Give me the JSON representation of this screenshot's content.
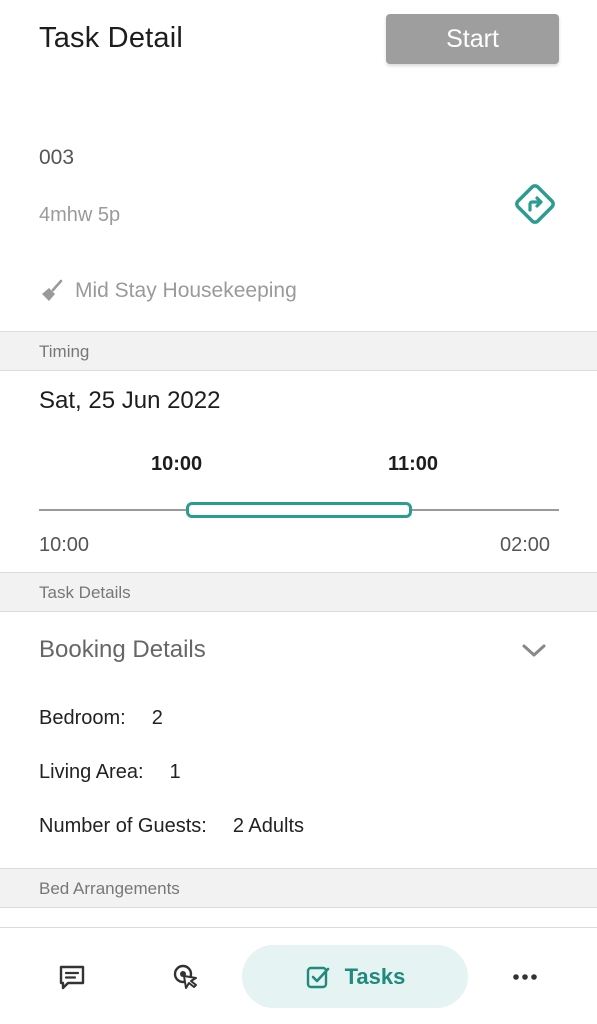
{
  "header": {
    "title": "Task Detail",
    "start_label": "Start"
  },
  "task": {
    "id": "003",
    "subtitle": "4mhw 5p",
    "type": "Mid Stay Housekeeping"
  },
  "sections": {
    "timing": "Timing",
    "task_details": "Task Details",
    "bed_arrangements": "Bed Arrangements"
  },
  "timing": {
    "date": "Sat, 25 Jun 2022",
    "window_start": "10:00",
    "window_end": "11:00",
    "range_start": "10:00",
    "range_end": "02:00"
  },
  "booking": {
    "title": "Booking Details",
    "rows": [
      {
        "label": "Bedroom:",
        "value": "2"
      },
      {
        "label": "Living Area:",
        "value": "1"
      },
      {
        "label": "Number of Guests:",
        "value": "2 Adults"
      }
    ]
  },
  "nav": {
    "tasks_label": "Tasks"
  },
  "icons": {
    "direction": "direction-icon",
    "task_type": "broom-icon",
    "collapse": "chevron-down-icon",
    "messages": "message-icon",
    "location": "location-pointer-icon",
    "tasks": "task-check-icon",
    "more": "more-dots-icon"
  },
  "colors": {
    "accent": "#2a9d8f",
    "start_button": "#9e9e9e",
    "tasks_pill": "#e5f3f2"
  }
}
